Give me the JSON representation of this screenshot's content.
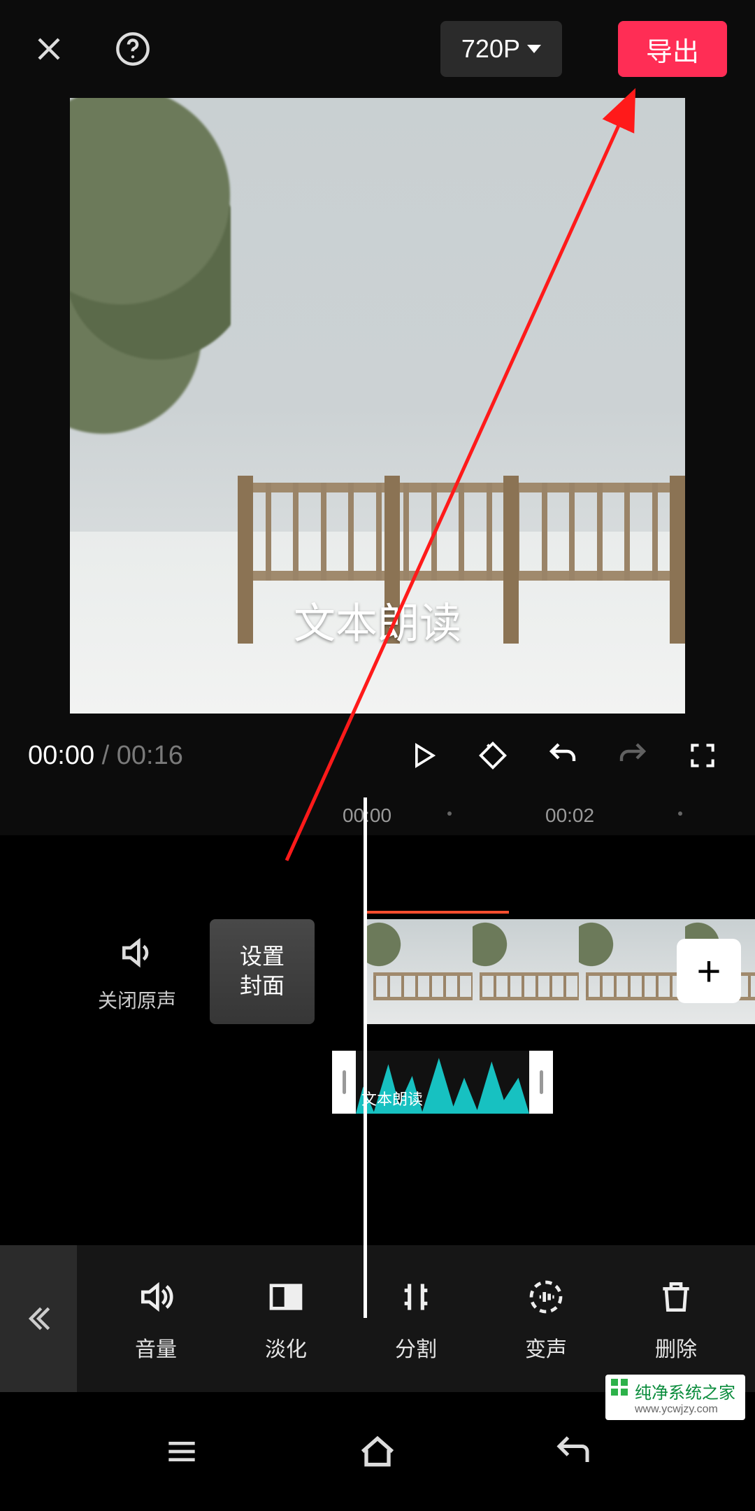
{
  "topbar": {
    "resolution_label": "720P",
    "export_label": "导出"
  },
  "preview": {
    "caption": "文本朗读"
  },
  "playback": {
    "current": "00:00",
    "separator": " / ",
    "duration": "00:16"
  },
  "ruler": {
    "ticks": [
      "00:00",
      "00:02"
    ]
  },
  "timeline": {
    "mute_label": "关闭原声",
    "cover_label": "设置\n封面",
    "audio_clip_label": "文本朗读",
    "add_label": "+"
  },
  "tools": {
    "items": [
      {
        "id": "volume",
        "label": "音量",
        "icon": "volume-icon"
      },
      {
        "id": "fade",
        "label": "淡化",
        "icon": "fade-icon"
      },
      {
        "id": "split",
        "label": "分割",
        "icon": "split-icon"
      },
      {
        "id": "voice",
        "label": "变声",
        "icon": "voice-change-icon"
      },
      {
        "id": "delete",
        "label": "删除",
        "icon": "trash-icon"
      }
    ]
  },
  "watermark": {
    "title": "纯净系统之家",
    "url": "www.ycwjzy.com"
  },
  "colors": {
    "accent": "#ff2d55",
    "arrow": "#ff1a1a",
    "audio_wave": "#17c1c1"
  }
}
